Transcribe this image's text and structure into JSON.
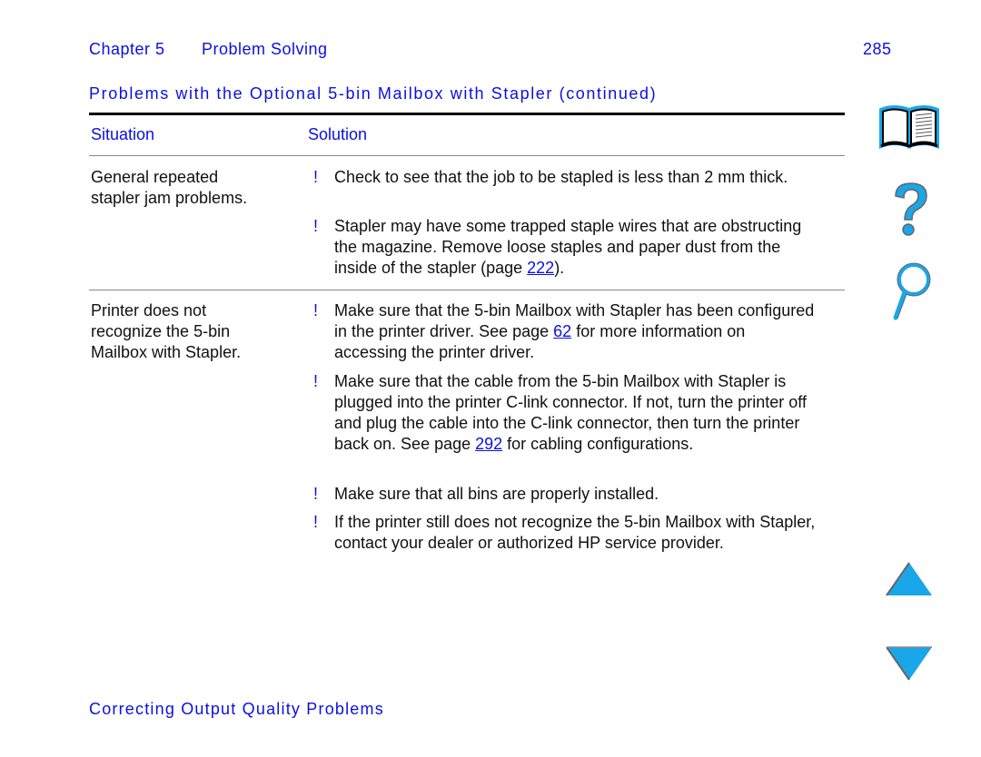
{
  "header": {
    "chapter": "Chapter 5",
    "section": "Problem Solving",
    "page_number": "285"
  },
  "title": "Problems with the Optional 5-bin Mailbox with Stapler (continued)",
  "table": {
    "headers": [
      "Situation",
      "Solution"
    ],
    "rows": [
      {
        "situation": [
          "General repeated",
          "stapler jam problems."
        ],
        "bullets": [
          {
            "bullet": "!",
            "pre": "Check to see that the job to be stapled is less than 2 mm thick.",
            "link": "",
            "post": ""
          },
          {
            "bullet": "!",
            "pre": "Stapler may have some trapped staple wires that are obstructing the magazine. Remove loose staples and paper dust from the inside of the stapler (page ",
            "link": "222",
            "post": ")."
          }
        ]
      },
      {
        "situation": [
          "Printer does not",
          "recognize the 5-bin",
          "Mailbox with Stapler."
        ],
        "bullets": [
          {
            "bullet": "!",
            "pre": "Make sure that the 5-bin Mailbox with Stapler has been configured in the printer driver. See page ",
            "link": "62",
            "post": " for more information on accessing the printer driver."
          },
          {
            "bullet": "!",
            "pre": "Make sure that the cable from the 5-bin Mailbox with Stapler is plugged into the printer C-link connector. If not, turn the printer off and plug the cable into the C-link connector, then turn the printer back on. See page ",
            "link": "292",
            "post": " for cabling configurations."
          },
          {
            "bullet": "!",
            "pre": "Make sure that all bins are properly installed.",
            "link": "",
            "post": ""
          },
          {
            "bullet": "!",
            "pre": "If the printer still does not recognize the 5-bin Mailbox with Stapler, contact your dealer or authorized HP service provider.",
            "link": "",
            "post": ""
          }
        ]
      }
    ]
  },
  "footer": "Correcting Output Quality Problems",
  "nav_icons": [
    "book-contents-icon",
    "help-question-icon",
    "search-magnifier-icon",
    "previous-page-arrow-icon",
    "next-page-arrow-icon"
  ],
  "colors": {
    "text_accent": "#0a10e0",
    "icon_fill": "#1aa6e8"
  }
}
